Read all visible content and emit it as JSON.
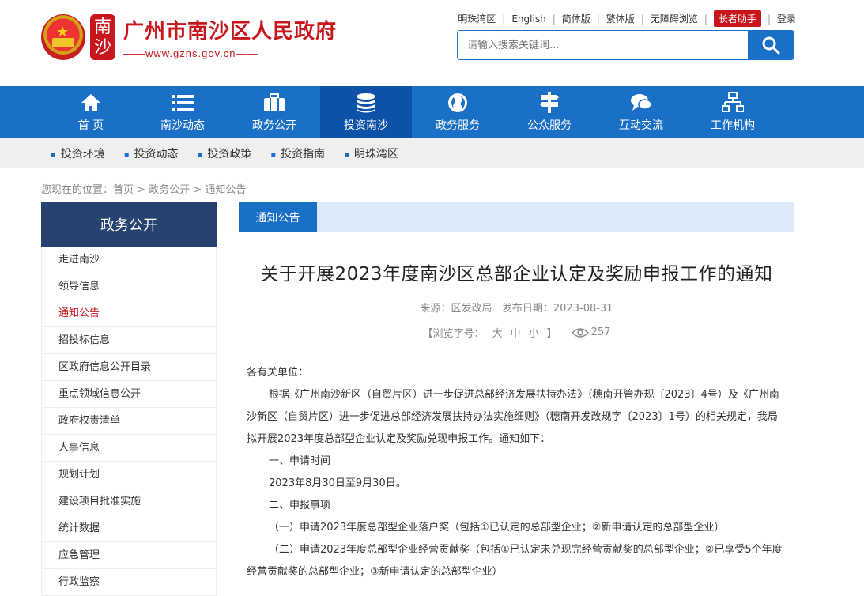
{
  "site": {
    "title": "广州市南沙区人民政府",
    "url": "——www.gzns.gov.cn——",
    "seal_text": "南沙"
  },
  "toplinks": [
    "明珠湾区",
    "English",
    "简体版",
    "繁体版",
    "无障碍浏览"
  ],
  "elder_label": "长者助手",
  "login_label": "登录",
  "search": {
    "placeholder": "请输入搜索关键词..."
  },
  "nav": [
    {
      "label": "首 页",
      "icon": "home-icon"
    },
    {
      "label": "南沙动态",
      "icon": "list-icon"
    },
    {
      "label": "政务公开",
      "icon": "briefcase-icon"
    },
    {
      "label": "投资南沙",
      "icon": "coins-icon"
    },
    {
      "label": "政务服务",
      "icon": "globe-icon"
    },
    {
      "label": "公众服务",
      "icon": "signpost-icon"
    },
    {
      "label": "互动交流",
      "icon": "chat-icon"
    },
    {
      "label": "工作机构",
      "icon": "org-chart-icon"
    }
  ],
  "active_nav": 3,
  "subnav": [
    "投资环境",
    "投资动态",
    "投资政策",
    "投资指南",
    "明珠湾区"
  ],
  "breadcrumb": "您现在的位置：首页 > 政务公开 > 通知公告",
  "sidebar": {
    "title": "政务公开",
    "items": [
      "走进南沙",
      "领导信息",
      "通知公告",
      "招投标信息",
      "区政府信息公开目录",
      "重点领域信息公开",
      "政府权责清单",
      "人事信息",
      "规划计划",
      "建设项目批准实施",
      "统计数据",
      "应急管理",
      "行政监察"
    ],
    "active": 2
  },
  "tab_label": "通知公告",
  "article": {
    "title": "关于开展2023年度南沙区总部企业认定及奖励申报工作的通知",
    "meta": "来源：区发改局   发布日期：2023-08-31",
    "fontsize_label": "【浏览字号：",
    "size_large": "大",
    "size_medium": "中",
    "size_small": "小",
    "fontsize_end": "】",
    "views": "257",
    "greeting": "各有关单位：",
    "p1": "根据《广州南沙新区（自贸片区）进一步促进总部经济发展扶持办法》（穗南开管办规〔2023〕4号）及《广州南沙新区（自贸片区）进一步促进总部经济发展扶持办法实施细则》（穗南开发改规字〔2023〕1号）的相关规定，我局拟开展2023年度总部型企业认定及奖励兑现申报工作。通知如下：",
    "h1": "一、申请时间",
    "t1": "2023年8月30日至9月30日。",
    "h2": "二、申报事项",
    "i1": "（一）申请2023年度总部型企业落户奖（包括①已认定的总部型企业；②新申请认定的总部型企业）",
    "i2": "（二）申请2023年度总部型企业经营贡献奖（包括①已认定未兑现完经营贡献奖的总部型企业；②已享受5个年度经营贡献奖的总部型企业；③新申请认定的总部型企业）"
  }
}
